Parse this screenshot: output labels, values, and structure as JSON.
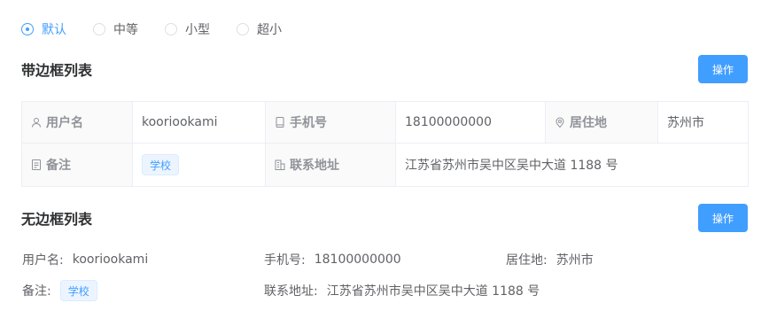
{
  "size_options": [
    {
      "label": "默认",
      "checked": true
    },
    {
      "label": "中等",
      "checked": false
    },
    {
      "label": "小型",
      "checked": false
    },
    {
      "label": "超小",
      "checked": false
    }
  ],
  "bordered_section": {
    "title": "带边框列表",
    "action_label": "操作",
    "username_label": "用户名",
    "username": "kooriookami",
    "phone_label": "手机号",
    "phone": "18100000000",
    "residence_label": "居住地",
    "residence": "苏州市",
    "remark_label": "备注",
    "remark_tag": "学校",
    "address_label": "联系地址",
    "address": "江苏省苏州市吴中区吴中大道 1188 号"
  },
  "plain_section": {
    "title": "无边框列表",
    "action_label": "操作",
    "username_label": "用户名:",
    "username": "kooriookami",
    "phone_label": "手机号:",
    "phone": "18100000000",
    "residence_label": "居住地:",
    "residence": "苏州市",
    "remark_label": "备注:",
    "remark_tag": "学校",
    "address_label": "联系地址:",
    "address": "江苏省苏州市吴中区吴中大道 1188 号"
  },
  "colors": {
    "primary": "#409eff",
    "label_bg": "#fafafa",
    "border": "#ebeef5"
  }
}
